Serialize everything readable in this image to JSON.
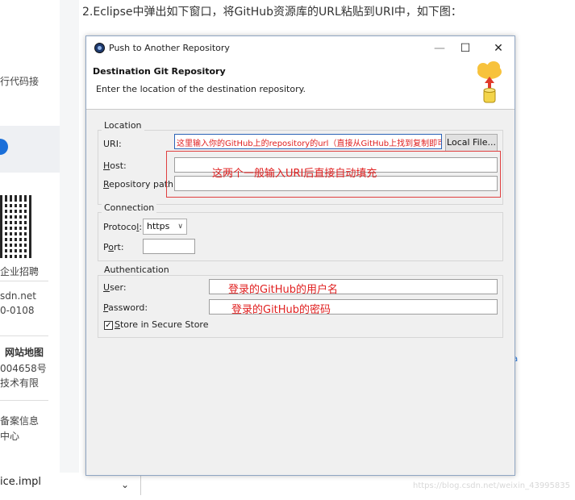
{
  "background": {
    "article_heading": "2.Eclipse中弹出如下窗口，将GitHub资源库的URL粘贴到URI中，如下图：",
    "left_fragments": [
      {
        "text": "行代码接"
      },
      {
        "text": "企业招聘"
      },
      {
        "text": "sdn.net"
      },
      {
        "text": "0-0108"
      },
      {
        "text": "网站地图"
      },
      {
        "text": "004658号"
      },
      {
        "text": "技术有限"
      },
      {
        "text": "备案信息"
      },
      {
        "text": "中心"
      }
    ],
    "bottom_fragment": "ice.impl",
    "watermark": "https://blog.csdn.net/weixin_43995835"
  },
  "dialog": {
    "title": "Push to Another Repository",
    "minimize": "—",
    "maximize": "☐",
    "close": "✕",
    "header_title": "Destination Git Repository",
    "header_desc": "Enter the location of the destination repository.",
    "location": {
      "group_label": "Location",
      "uri_label": "URI:",
      "uri_value": "这里输入你的GitHub上的repository的url（直接从GitHub上找到复制即可）",
      "local_file_button": "Local File...",
      "host_label": "Host:",
      "host_value": "",
      "repo_path_label": "Repository path:",
      "repo_path_value": "",
      "autofill_annotation": "这两个一般输入URI后直接自动填充"
    },
    "connection": {
      "group_label": "Connection",
      "protocol_label": "Protocol:",
      "protocol_value": "https",
      "port_label": "Port:",
      "port_value": ""
    },
    "authentication": {
      "group_label": "Authentication",
      "user_label": "User:",
      "user_annotation": "登录的GitHub的用户名",
      "password_label": "Password:",
      "password_annotation": "登录的GitHub的密码",
      "store_label": "Store in Secure Store",
      "store_checked": true
    }
  },
  "colors": {
    "annotation_red": "#e02020",
    "focus_blue": "#2b62b6",
    "dialog_bg": "#f0f0f0"
  }
}
